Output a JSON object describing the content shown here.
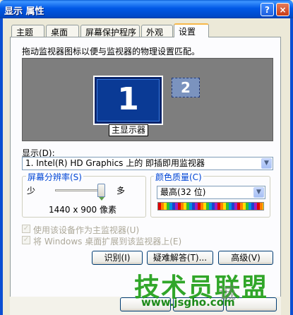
{
  "window": {
    "title": "显示 属性",
    "help_glyph": "?",
    "close_glyph": "×"
  },
  "tabs": [
    {
      "label": "主题"
    },
    {
      "label": "桌面"
    },
    {
      "label": "屏幕保护程序"
    },
    {
      "label": "外观"
    },
    {
      "label": "设置",
      "active": true
    }
  ],
  "settings": {
    "description": "拖动监视器图标以便与监视器的物理设置匹配。",
    "monitors": [
      {
        "number": "1",
        "label": "主显示器",
        "primary": true
      },
      {
        "number": "2",
        "primary": false
      }
    ],
    "display_label": "显示(D):",
    "display_value": "1. Intel(R) HD Graphics 上的 即插即用监视器",
    "resolution": {
      "title": "屏幕分辨率(S)",
      "less": "少",
      "more": "多",
      "value": "1440 x 900 像素",
      "slider_fraction": 1.0
    },
    "color_quality": {
      "title": "颜色质量(C)",
      "value": "最高(32 位)"
    },
    "checkboxes": [
      {
        "label": "使用该设备作为主监视器(U)",
        "checked": true,
        "enabled": false
      },
      {
        "label": "将 Windows 桌面扩展到该监视器上(E)",
        "checked": true,
        "enabled": false
      }
    ],
    "buttons": {
      "identify": "识别(I)",
      "troubleshoot": "疑难解答(T)...",
      "advanced": "高级(V)"
    }
  },
  "watermark": {
    "brand": "技术员联盟",
    "city": "诚",
    "site": "www.jsgho.com"
  },
  "colors": {
    "title_bar": "#0058E6",
    "dialog_bg": "#ECE9D8",
    "monitor_primary": "#0A3A95",
    "group_title": "#0046D5",
    "watermark_green": "#27A21E"
  }
}
